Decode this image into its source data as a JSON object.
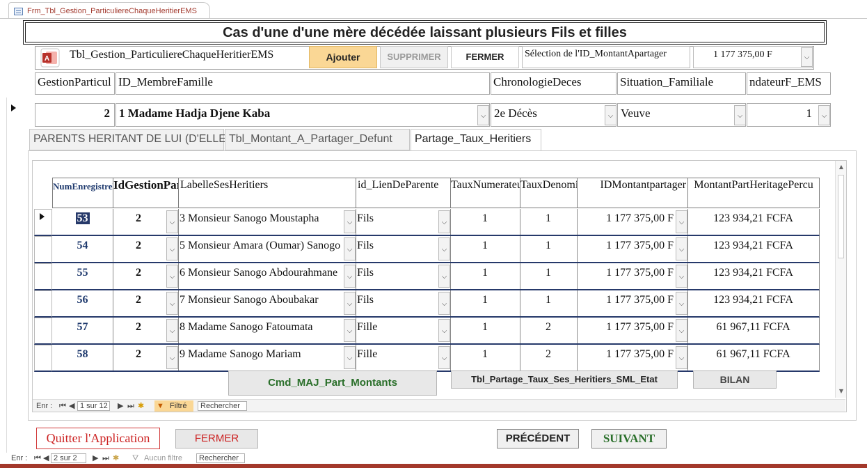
{
  "window": {
    "tab_title": "Frm_Tbl_Gestion_ParticuliereChaqueHeritierEMS"
  },
  "title": "Cas d'une d'une mère décédée laissant plusieurs Fils et filles",
  "header": {
    "table_name": "Tbl_Gestion_ParticuliereChaqueHeritierEMS",
    "ajouter": "Ajouter",
    "supprimer": "SUPPRIMER",
    "fermer": "FERMER",
    "selection_label": "Sélection de l'ID_MontantApartager",
    "selection_value": "1 177 375,00 F"
  },
  "columns": {
    "c1": "GestionParticul",
    "c2": "ID_MembreFamille",
    "c3": "ChronologieDeces",
    "c4": "Situation_Familiale",
    "c5": "ndateurF_EMS"
  },
  "record": {
    "id": "2",
    "membre": "1 Madame Hadja  Djene Kaba",
    "chronologie": "2e Décès",
    "situation": "Veuve",
    "fondateur": "1"
  },
  "tabs": {
    "t1": "PARENTS HERITANT DE LUI (D'ELLE)",
    "t2": "Tbl_Montant_A_Partager_Defunt",
    "t3": "Partage_Taux_Heritiers"
  },
  "grid": {
    "headers": {
      "num": "NumEnregistreHeritier",
      "idg": "IdGestionParticul",
      "label": "LabelleSesHeritiers",
      "lien": "id_LienDeParente",
      "num_taux": "TauxNumerateurLP",
      "den_taux": "TauxDenominateurL",
      "idmont": "IDMontantpartager",
      "montant": "MontantPartHeritagePercu"
    },
    "rows": [
      {
        "num": "53",
        "idg": "2",
        "label": "3 Monsieur Sanogo Moustapha",
        "lien": "Fils",
        "tn": "1",
        "td": "1",
        "idm": "1 177 375,00 F",
        "mont": "123 934,21 FCFA"
      },
      {
        "num": "54",
        "idg": "2",
        "label": "5 Monsieur Amara (Oumar) Sanogo",
        "lien": "Fils",
        "tn": "1",
        "td": "1",
        "idm": "1 177 375,00 F",
        "mont": "123 934,21 FCFA"
      },
      {
        "num": "55",
        "idg": "2",
        "label": "6 Monsieur Sanogo Abdourahmane",
        "lien": "Fils",
        "tn": "1",
        "td": "1",
        "idm": "1 177 375,00 F",
        "mont": "123 934,21 FCFA"
      },
      {
        "num": "56",
        "idg": "2",
        "label": "7 Monsieur Sanogo Aboubakar",
        "lien": "Fils",
        "tn": "1",
        "td": "1",
        "idm": "1 177 375,00 F",
        "mont": "123 934,21 FCFA"
      },
      {
        "num": "57",
        "idg": "2",
        "label": "8 Madame Sanogo Fatoumata",
        "lien": "Fille",
        "tn": "1",
        "td": "2",
        "idm": "1 177 375,00 F",
        "mont": "61 967,11 FCFA"
      },
      {
        "num": "58",
        "idg": "2",
        "label": "9 Madame Sanogo Mariam",
        "lien": "Fille",
        "tn": "1",
        "td": "2",
        "idm": "1 177 375,00 F",
        "mont": "61 967,11 FCFA"
      }
    ]
  },
  "subform_buttons": {
    "cmd": "Cmd_MAJ_Part_Montants",
    "etat": "Tbl_Partage_Taux_Ses_Heritiers_SML_Etat",
    "bilan": "BILAN"
  },
  "sub_nav": {
    "enr": "Enr :",
    "pos": "1 sur 12",
    "filtre": "Filtré",
    "search": "Rechercher"
  },
  "main_buttons": {
    "quitter": "Quitter l'Application",
    "fermer": "FERMER",
    "precedent": "PRÉCÉDENT",
    "suivant": "SUIVANT"
  },
  "main_nav": {
    "enr": "Enr :",
    "pos": "2 sur 2",
    "filtre": "Aucun filtre",
    "search": "Rechercher"
  },
  "colors": {
    "accent": "#a3382b",
    "ajouter_bg": "#fad795",
    "grid_id": "#1f3a6e",
    "green": "#2a6f2a",
    "red": "#cc2222"
  }
}
